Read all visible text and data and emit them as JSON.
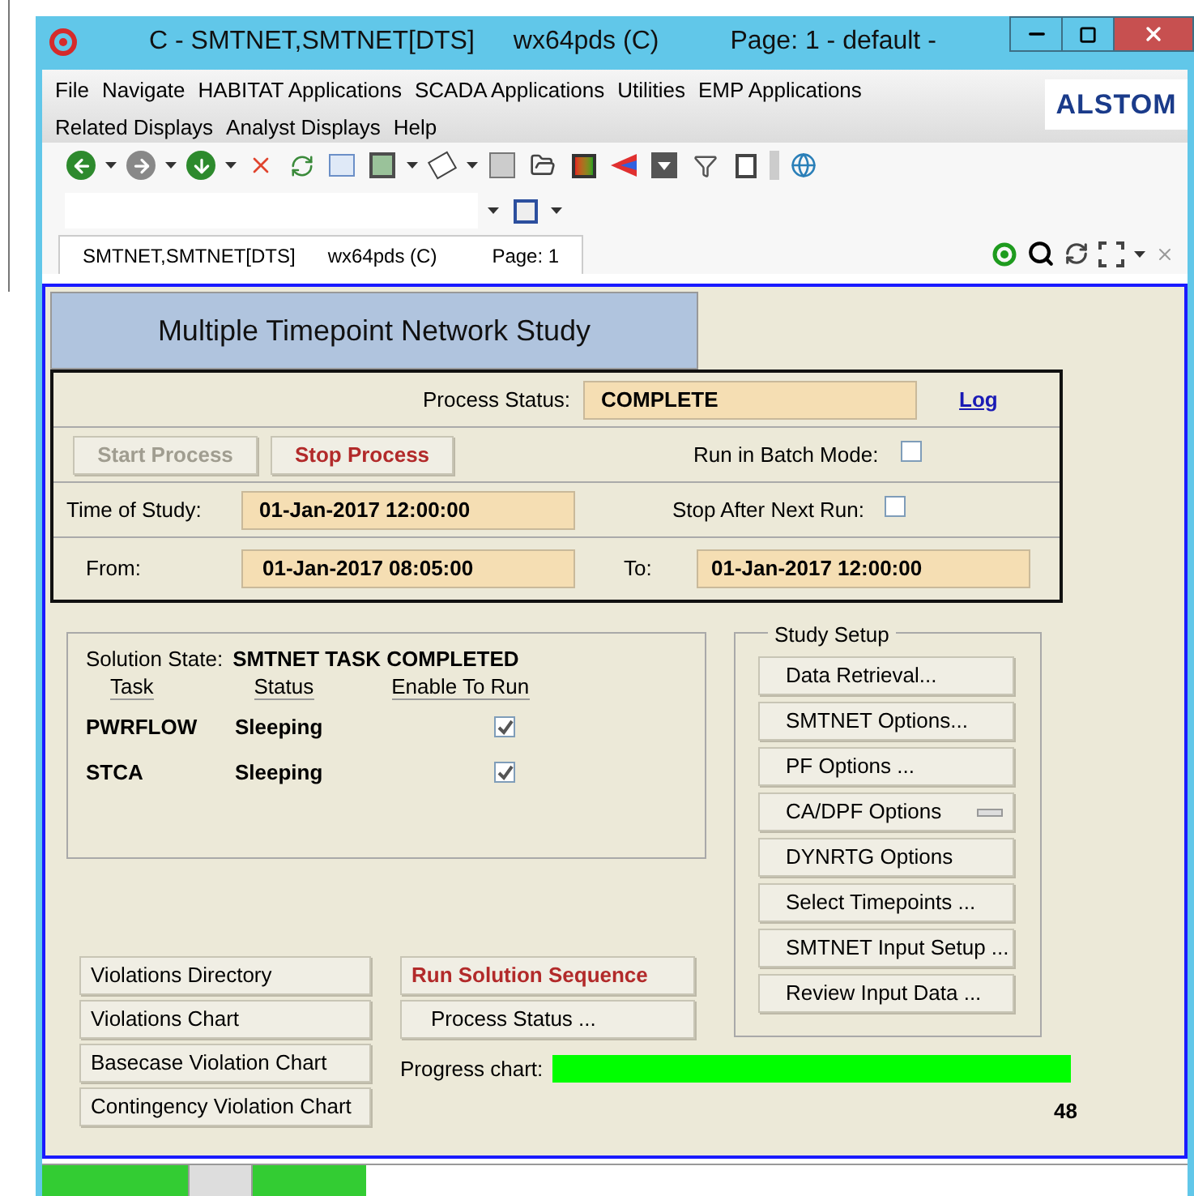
{
  "window": {
    "title_parts": [
      "C - SMTNET,SMTNET[DTS]",
      "wx64pds (C)",
      "Page: 1 - default -"
    ]
  },
  "menu": {
    "items": [
      "File",
      "Navigate",
      "HABITAT Applications",
      "SCADA Applications",
      "Utilities",
      "EMP Applications",
      "Related Displays",
      "Analyst Displays",
      "Help"
    ],
    "logo": "ALSTOM"
  },
  "tab": {
    "parts": [
      "SMTNET,SMTNET[DTS]",
      "wx64pds (C)",
      "Page: 1"
    ]
  },
  "study": {
    "title": "Multiple Timepoint Network Study",
    "process_status": {
      "label": "Process Status:",
      "value": "COMPLETE",
      "link": "Log"
    },
    "buttons": [
      {
        "label": "Start Process",
        "disabled": true
      },
      {
        "label": "Stop Process",
        "disabled": false
      }
    ],
    "batch_mode": {
      "label": "Run in Batch Mode:",
      "checked": false
    },
    "time_of_study": {
      "label": "Time of Study:",
      "value": "01-Jan-2017 12:00:00"
    },
    "stop_after": {
      "label": "Stop After Next Run:",
      "checked": false
    },
    "from": {
      "label": "From:",
      "value": "01-Jan-2017 08:05:00"
    },
    "to": {
      "label": "To:",
      "value": "01-Jan-2017 12:00:00"
    }
  },
  "solution": {
    "label": "Solution State:",
    "value": "SMTNET TASK COMPLETED",
    "columns": [
      "Task",
      "Status",
      "Enable To Run"
    ],
    "rows": [
      {
        "task": "PWRFLOW",
        "status": "Sleeping",
        "checked": true
      },
      {
        "task": "STCA",
        "status": "Sleeping",
        "checked": true
      }
    ]
  },
  "study_setup": {
    "title": "Study Setup",
    "buttons": [
      {
        "label": "Data Retrieval...",
        "kind": "plain"
      },
      {
        "label": "SMTNET Options...",
        "kind": "plain"
      },
      {
        "label": "PF Options ...",
        "kind": "plain"
      },
      {
        "label": "CA/DPF Options",
        "kind": "menu"
      },
      {
        "label": "DYNRTG Options",
        "kind": "plain"
      },
      {
        "label": "Select Timepoints ...",
        "kind": "plain"
      },
      {
        "label": "SMTNET Input Setup ...",
        "kind": "plain"
      },
      {
        "label": "Review Input Data ...",
        "kind": "plain"
      }
    ]
  },
  "chart_buttons": [
    "Violations Directory",
    "Violations Chart",
    "Basecase Violation Chart",
    "Contingency Violation Chart"
  ],
  "run_buttons": [
    {
      "label": "Run Solution Sequence",
      "highlighted": true
    },
    {
      "label": "Process Status ...",
      "highlighted": false
    }
  ],
  "progress": {
    "label": "Progress chart:",
    "level": 1,
    "count": "48"
  }
}
